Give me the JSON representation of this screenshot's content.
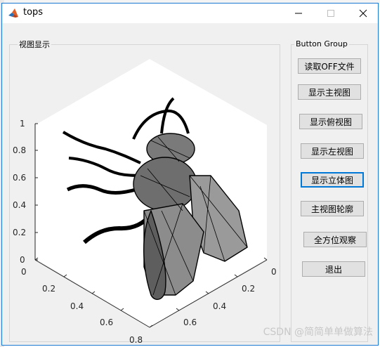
{
  "window": {
    "title": "tops"
  },
  "plot_panel": {
    "title": "视图显示"
  },
  "button_group": {
    "title": "Button Group",
    "buttons": [
      {
        "label": "读取OFF文件"
      },
      {
        "label": "显示主视图"
      },
      {
        "label": "显示俯视图"
      },
      {
        "label": "显示左视图"
      },
      {
        "label": "显示立体图"
      },
      {
        "label": "主视图轮廓"
      },
      {
        "label": "全方位观察"
      },
      {
        "label": "退出"
      }
    ]
  },
  "axes": {
    "z_ticks": [
      "0",
      "0.2",
      "0.4",
      "0.6",
      "0.8",
      "1"
    ],
    "x_ticks": [
      "0",
      "0.2",
      "0.4",
      "0.6",
      "0.8"
    ],
    "y_ticks": [
      "0",
      "0.2",
      "0.4",
      "0.6"
    ]
  },
  "watermark": "CSDN @简简单单做算法",
  "colors": {
    "accent": "#0078d7",
    "mesh_fill": "#8a8a8a",
    "mesh_edge": "#000000"
  }
}
